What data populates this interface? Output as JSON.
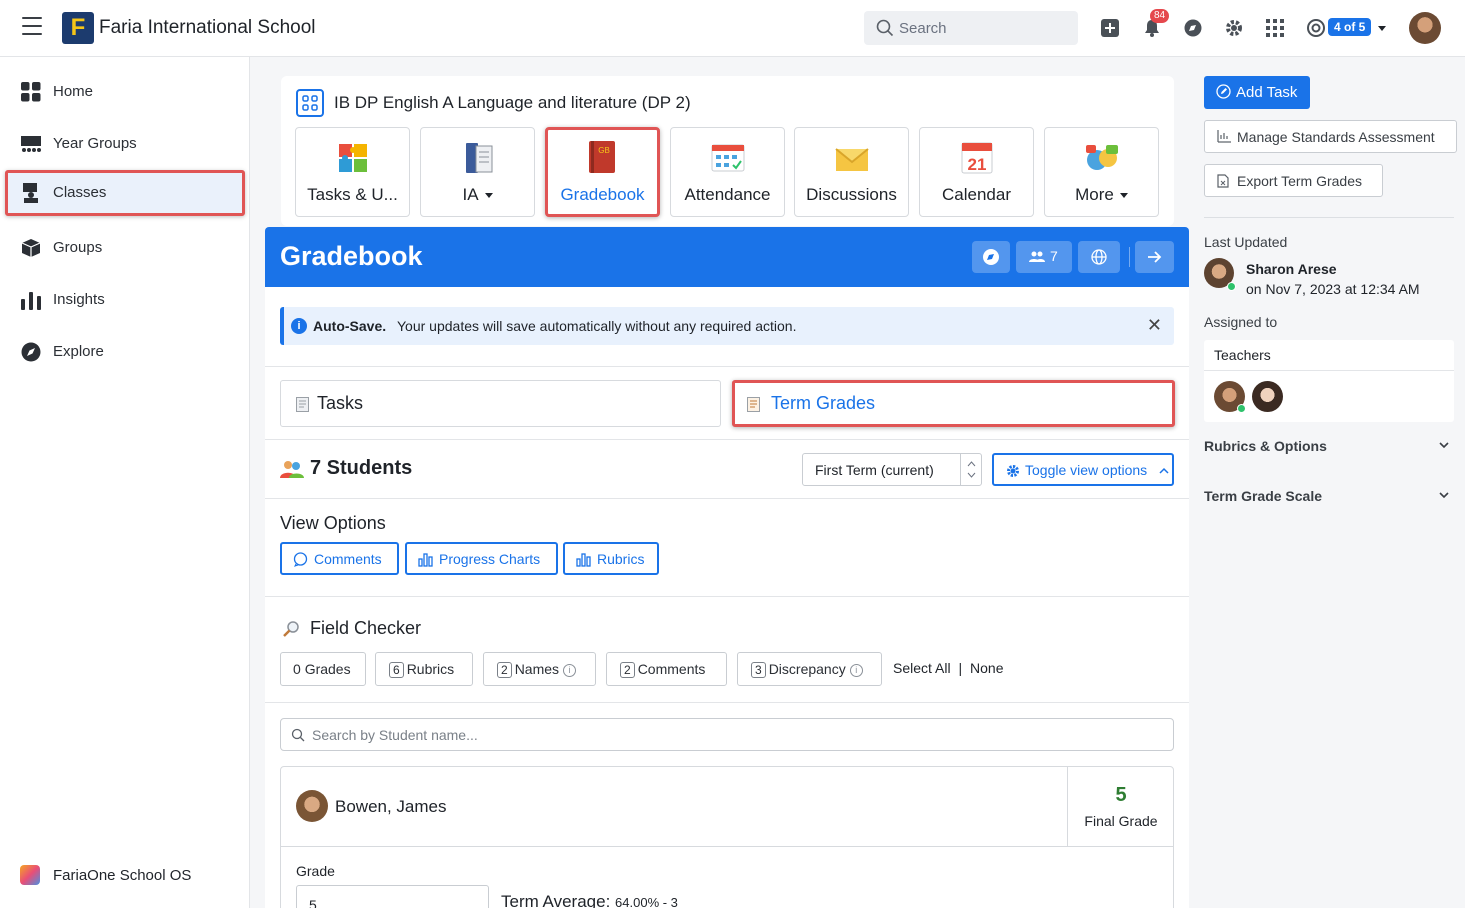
{
  "topbar": {
    "school_name": "Faria International School",
    "logo_letter": "F",
    "search_placeholder": "Search",
    "notification_count": "84",
    "switcher_label": "4 of 5"
  },
  "sidebar": {
    "items": [
      {
        "label": "Home",
        "icon": "home-grid-icon"
      },
      {
        "label": "Year Groups",
        "icon": "year-groups-icon"
      },
      {
        "label": "Classes",
        "icon": "classes-icon"
      },
      {
        "label": "Groups",
        "icon": "groups-cube-icon"
      },
      {
        "label": "Insights",
        "icon": "insights-bars-icon"
      },
      {
        "label": "Explore",
        "icon": "explore-compass-icon"
      }
    ],
    "footer_label": "FariaOne School OS"
  },
  "class_card": {
    "title": "IB DP English A Language and literature (DP 2)",
    "tools": [
      {
        "label": "Tasks & U...",
        "icon": "puzzle-icon"
      },
      {
        "label": "IA",
        "icon": "ia-book-icon"
      },
      {
        "label": "Gradebook",
        "icon": "gradebook-icon",
        "badge": "GB"
      },
      {
        "label": "Attendance",
        "icon": "attendance-icon"
      },
      {
        "label": "Discussions",
        "icon": "envelope-icon"
      },
      {
        "label": "Calendar",
        "icon": "calendar-icon",
        "day": "21"
      },
      {
        "label": "More",
        "icon": "more-icon"
      }
    ]
  },
  "gradebook": {
    "title": "Gradebook",
    "members_count": "7",
    "autosave_bold": "Auto-Save.",
    "autosave_text": "Your updates will save automatically without any required action.",
    "close_symbol": "✕",
    "tabs": [
      {
        "label": "Tasks"
      },
      {
        "label": "Term Grades"
      }
    ],
    "students_title": "7 Students",
    "term_select_value": "First Term (current)",
    "toggle_label": "Toggle view options",
    "view_options_title": "View Options",
    "view_options": [
      "Comments",
      "Progress Charts",
      "Rubrics"
    ],
    "field_checker_title": "Field Checker",
    "field_checks": [
      {
        "count": "0",
        "label": "Grades"
      },
      {
        "count": "6",
        "label": "Rubrics"
      },
      {
        "count": "2",
        "label": "Names"
      },
      {
        "count": "2",
        "label": "Comments"
      },
      {
        "count": "3",
        "label": "Discrepancy"
      }
    ],
    "select_all": "Select All",
    "select_sep": "|",
    "select_none": "None",
    "student_search_placeholder": "Search by Student name...",
    "student": {
      "name": "Bowen, James",
      "final_grade": "5",
      "final_grade_label": "Final Grade",
      "grade_label": "Grade",
      "grade_value": "5",
      "term_average_label": "Term Average:",
      "term_average_value": "64.00% - 3"
    }
  },
  "right_panel": {
    "add_task": "Add Task",
    "manage_standards": "Manage Standards Assessment",
    "export_term_grades": "Export Term Grades",
    "last_updated_label": "Last Updated",
    "updater_name": "Sharon Arese",
    "updated_on": "on Nov 7, 2023 at 12:34 AM",
    "assigned_to_label": "Assigned to",
    "teachers_label": "Teachers",
    "rubrics_options": "Rubrics & Options",
    "term_grade_scale": "Term Grade Scale"
  },
  "colors": {
    "accent": "#1a73e8",
    "highlight": "#e05555",
    "success": "#2e7d32"
  }
}
